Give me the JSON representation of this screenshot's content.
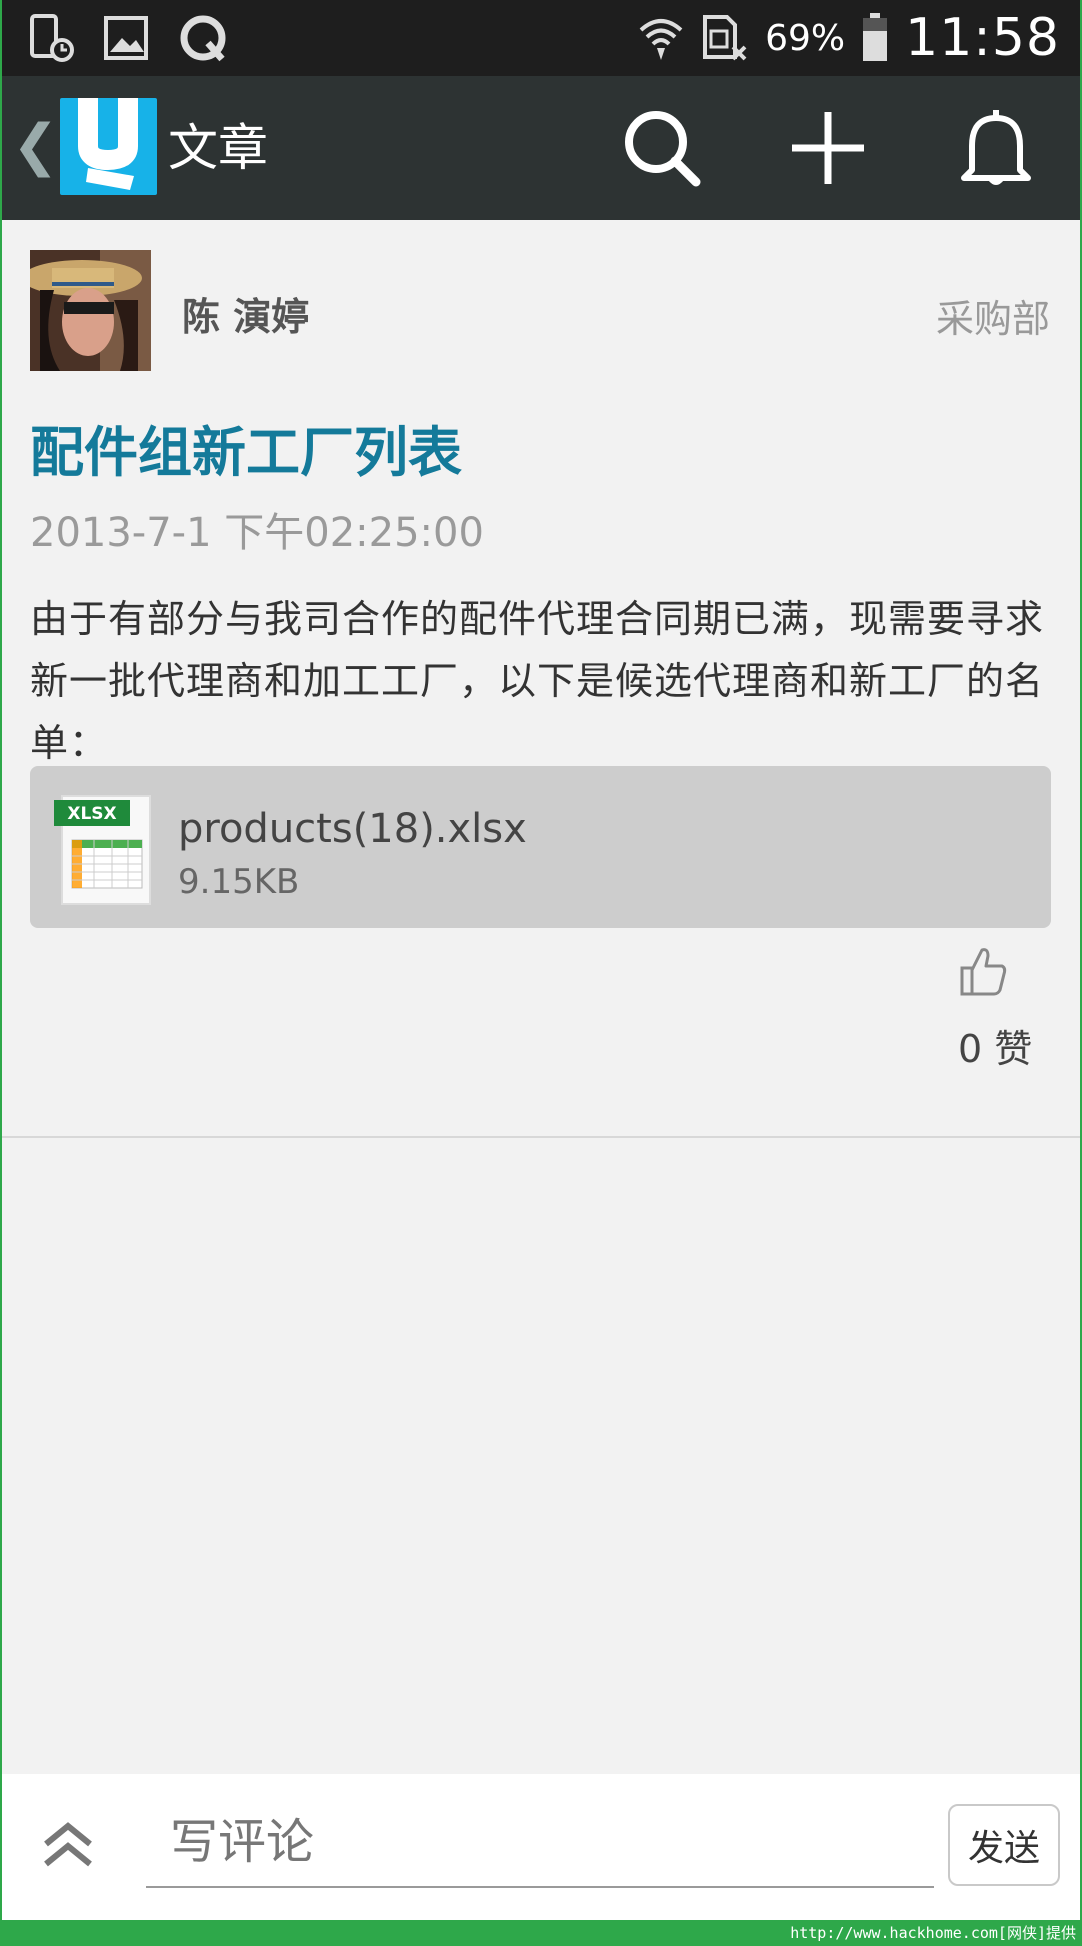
{
  "status_bar": {
    "battery_percent": "69%",
    "time": "11:58"
  },
  "app_bar": {
    "back_glyph": "❮",
    "title": "文章",
    "icons": [
      "search-icon",
      "add-icon",
      "bell-icon"
    ]
  },
  "post": {
    "author": "陈 演婷",
    "department": "采购部",
    "title": "配件组新工厂列表",
    "datetime": "2013-7-1 下午02:25:00",
    "body": "由于有部分与我司合作的配件代理合同期已满，现需要寻求新一批代理商和加工工厂，以下是候选代理商和新工厂的名单：",
    "attachment": {
      "badge": "XLSX",
      "name": "products(18).xlsx",
      "size": "9.15KB"
    },
    "likes": "0 赞"
  },
  "comment_bar": {
    "placeholder": "写评论",
    "send_label": "发送"
  },
  "watermark": "http://www.hackhome.com[网侠]提供",
  "colors": {
    "status_bar": "#1e1e1e",
    "app_bar": "#2d3333",
    "logo": "#17b2e8",
    "title": "#147a9a",
    "frame_green": "#2ea84a"
  }
}
